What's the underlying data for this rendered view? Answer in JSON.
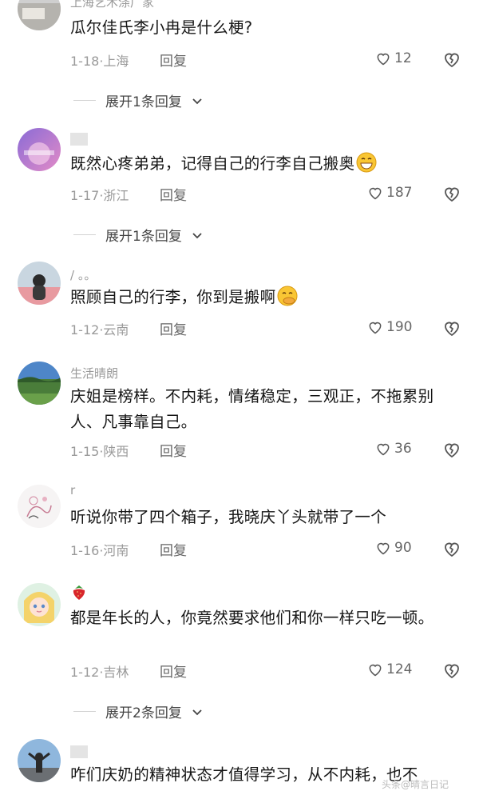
{
  "comments": [
    {
      "name": "上海艺术涤广家",
      "text": "瓜尔佳氏李小冉是什么梗?",
      "date": "1-18",
      "location": "上海",
      "reply_label": "回复",
      "likes": "12",
      "expand": "展开1条回复"
    },
    {
      "name": "",
      "text": "既然心疼弟弟，记得自己的行李自己搬奥",
      "date": "1-17",
      "location": "浙江",
      "reply_label": "回复",
      "likes": "187",
      "expand": "展开1条回复",
      "emoji": "grinning-face-emoji"
    },
    {
      "name": "/ 。。",
      "text": "照顾自己的行李，你到是搬啊",
      "date": "1-12",
      "location": "云南",
      "reply_label": "回复",
      "likes": "190",
      "emoji": "face-with-hand-over-mouth-emoji"
    },
    {
      "name": "生活晴朗",
      "text": "庆姐是榜样。不内耗，情绪稳定，三观正，不拖累别人、凡事靠自己。",
      "date": "1-15",
      "location": "陕西",
      "reply_label": "回复",
      "likes": "36"
    },
    {
      "name": "r",
      "text": "听说你带了四个箱子，我晓庆丫头就带了一个",
      "date": "1-16",
      "location": "河南",
      "reply_label": "回复",
      "likes": "90"
    },
    {
      "name": "",
      "text": "都是年长的人，你竟然要求他们和你一样只吃一顿。",
      "date": "1-12",
      "location": "吉林",
      "reply_label": "回复",
      "likes": "124",
      "expand": "展开2条回复",
      "name_emoji": "strawberry-emoji"
    },
    {
      "name": "",
      "text": "咋们庆奶的精神状态才值得学习，从不内耗，也不"
    }
  ],
  "separator": "·",
  "watermark": "头条@晴言日记",
  "colors": {
    "meta": "#9a9a9a",
    "text": "#151515",
    "heart": "#555555"
  }
}
